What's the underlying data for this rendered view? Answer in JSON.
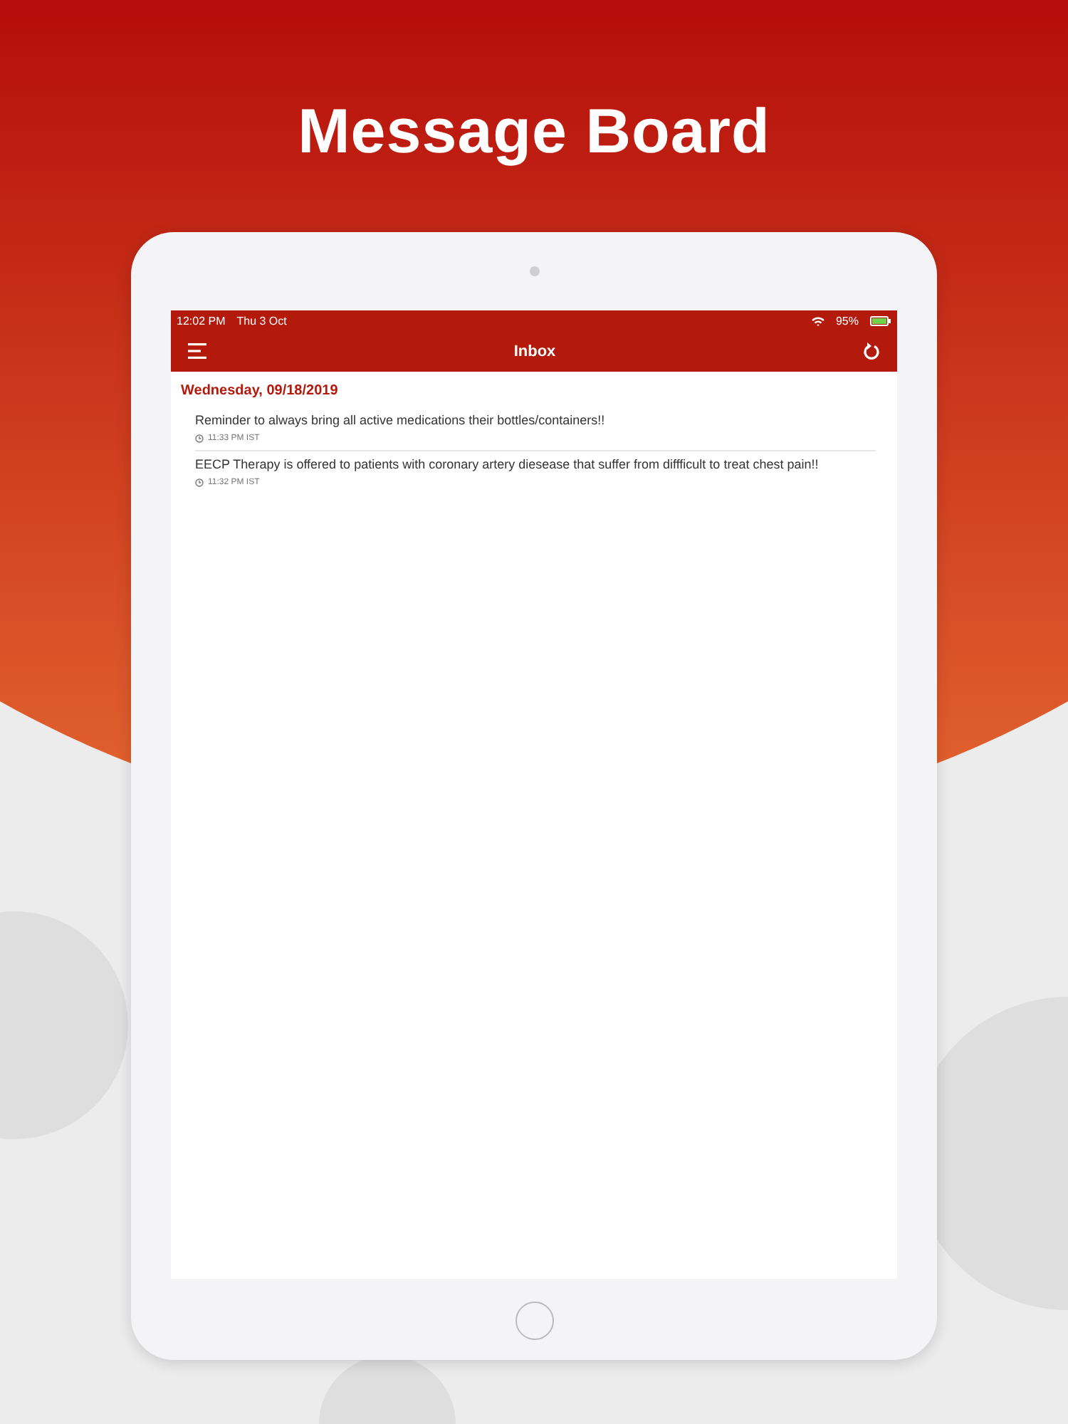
{
  "headline": "Message Board",
  "status_bar": {
    "time": "12:02 PM",
    "date": "Thu 3 Oct",
    "battery": "95%"
  },
  "nav_bar": {
    "title": "Inbox"
  },
  "groups": [
    {
      "date": "Wednesday, 09/18/2019",
      "messages": [
        {
          "text": "Reminder to always bring all active medications their bottles/containers!!",
          "time": "11:33 PM IST"
        },
        {
          "text": "EECP Therapy is offered to patients with coronary artery diesease that suffer from diffficult to treat chest pain!!",
          "time": "11:32 PM IST"
        }
      ]
    }
  ]
}
